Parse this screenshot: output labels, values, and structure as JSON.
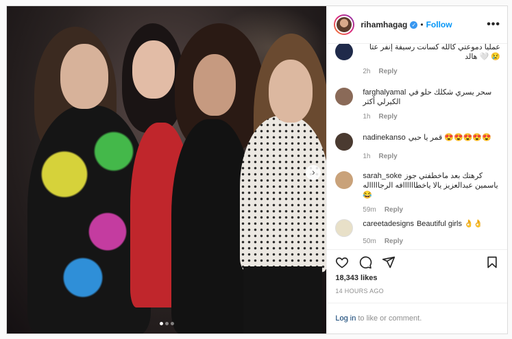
{
  "post": {
    "username": "rihamhagag",
    "follow_label": "Follow",
    "separator": "•",
    "more_label": "•••"
  },
  "photo": {
    "description_alt": "Four women posing together at a party",
    "carousel_next": "›",
    "carousel_count": 3,
    "carousel_active": 1
  },
  "comments": [
    {
      "user": "",
      "text": "عمليا دموعتي كالله كسانت رسيفة إنفر عتا 😢 🤍 هالد",
      "time": "2h",
      "reply": "Reply",
      "avatar_color": "#1f2a4a"
    },
    {
      "user": "farghalyamal",
      "text": "سحر يسري شكلك حلو في الكيرلي أكثر",
      "time": "1h",
      "reply": "Reply",
      "avatar_color": "#8a6a58"
    },
    {
      "user": "nadinekanso",
      "text": "😍😍😍😍😍 قمر يا حبي",
      "time": "1h",
      "reply": "Reply",
      "avatar_color": "#4a3a30"
    },
    {
      "user": "sarah_soke",
      "text": "كرهتك بعد ماخطفتي جوز ياسمين عبدالعزيز يالا ياخطاااااافه الرجاااااله 😂",
      "time": "59m",
      "reply": "Reply",
      "avatar_color": "#c9a27a"
    },
    {
      "user": "careetadesigns",
      "text": "Beautiful girls 👌👌",
      "time": "50m",
      "reply": "Reply",
      "avatar_color": "#e8e0c8"
    }
  ],
  "footer": {
    "likes": "18,343 likes",
    "time": "14 HOURS AGO",
    "login_link": "Log in",
    "login_text": "to like or comment."
  },
  "colors": {
    "accent": "#0095f6",
    "verified": "#3897f0",
    "meta": "#8e8e8e",
    "text": "#262626"
  },
  "icons": [
    "verified-icon",
    "more-icon",
    "heart-icon",
    "comment-icon",
    "share-icon",
    "bookmark-icon",
    "chevron-right-icon"
  ]
}
